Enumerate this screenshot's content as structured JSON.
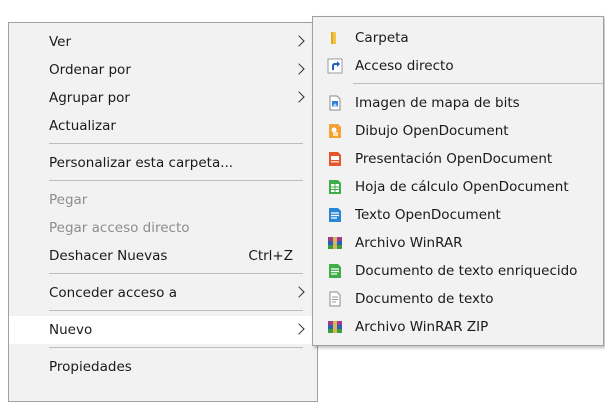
{
  "main_menu": {
    "items": [
      {
        "label": "Ver"
      },
      {
        "label": "Ordenar por"
      },
      {
        "label": "Agrupar por"
      },
      {
        "label": "Actualizar"
      },
      {
        "label": "Personalizar esta carpeta..."
      },
      {
        "label": "Pegar"
      },
      {
        "label": "Pegar acceso directo"
      },
      {
        "label": "Deshacer Nuevas",
        "shortcut": "Ctrl+Z"
      },
      {
        "label": "Conceder acceso a"
      },
      {
        "label": "Nuevo"
      },
      {
        "label": "Propiedades"
      }
    ]
  },
  "new_submenu": {
    "items": [
      {
        "label": "Carpeta",
        "icon": "folder-icon"
      },
      {
        "label": "Acceso directo",
        "icon": "shortcut-icon"
      },
      {
        "label": "Imagen de mapa de bits",
        "icon": "bitmap-icon"
      },
      {
        "label": "Dibujo OpenDocument",
        "icon": "odg-icon"
      },
      {
        "label": "Presentación OpenDocument",
        "icon": "odp-icon"
      },
      {
        "label": "Hoja de cálculo OpenDocument",
        "icon": "ods-icon"
      },
      {
        "label": "Texto OpenDocument",
        "icon": "odt-icon"
      },
      {
        "label": "Archivo WinRAR",
        "icon": "winrar-icon"
      },
      {
        "label": "Documento de texto enriquecido",
        "icon": "rtf-icon"
      },
      {
        "label": "Documento de texto",
        "icon": "txt-icon"
      },
      {
        "label": "Archivo WinRAR ZIP",
        "icon": "winrar-zip-icon"
      }
    ]
  },
  "colors": {
    "menu_background": "#f2f2f2",
    "highlight": "#ffffff",
    "disabled_text": "#8d8d8d",
    "separator": "#bdbdbd"
  }
}
